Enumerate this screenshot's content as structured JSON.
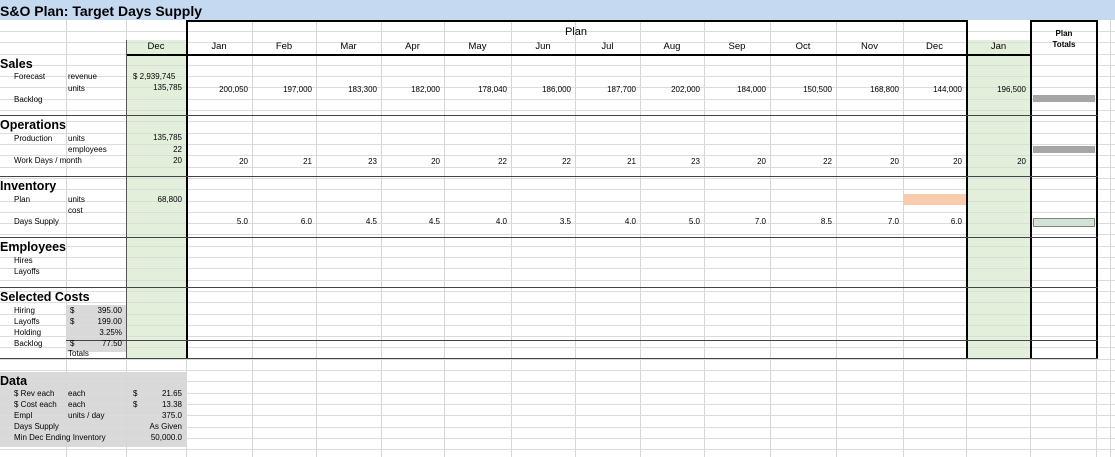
{
  "title": "S&O Plan:  Target Days Supply",
  "colors": {
    "title_band": "#c5d9f1",
    "green_column": "#e2efda",
    "gray_panel": "#d9d9d9",
    "peach_cell": "#f8cbad",
    "gray_bar": "#a6a6a6",
    "light_bar": "#d4e3d6"
  },
  "header": {
    "plan_label": "Plan",
    "plan_totals_line1": "Plan",
    "plan_totals_line2": "Totals",
    "months": [
      "Dec",
      "Jan",
      "Feb",
      "Mar",
      "Apr",
      "May",
      "Jun",
      "Jul",
      "Aug",
      "Sep",
      "Oct",
      "Nov",
      "Dec",
      "Jan"
    ]
  },
  "sections": {
    "sales": {
      "title": "Sales",
      "forecast_label": "Forecast",
      "revenue_label": "revenue",
      "units_label": "units",
      "backlog_label": "Backlog",
      "dec_revenue": "$ 2,939,745",
      "dec_units": "135,785",
      "units": [
        "200,050",
        "197,000",
        "183,300",
        "182,000",
        "178,040",
        "186,000",
        "187,700",
        "202,000",
        "184,000",
        "150,500",
        "168,800",
        "144,000"
      ],
      "jan_units": "196,500"
    },
    "operations": {
      "title": "Operations",
      "production_label": "Production",
      "units_label": "units",
      "employees_label": "employees",
      "workdays_label": "Work Days / month",
      "dec_units": "135,785",
      "dec_employees": "22",
      "dec_workdays": "20",
      "workdays": [
        "20",
        "21",
        "23",
        "20",
        "22",
        "22",
        "21",
        "23",
        "20",
        "22",
        "20",
        "20"
      ],
      "jan_workdays": "20"
    },
    "inventory": {
      "title": "Inventory",
      "plan_label": "Plan",
      "units_label": "units",
      "cost_label": "cost",
      "days_supply_label": "Days Supply",
      "dec_units": "68,800",
      "days_supply": [
        "5.0",
        "6.0",
        "4.5",
        "4.5",
        "4.0",
        "3.5",
        "4.0",
        "5.0",
        "7.0",
        "8.5",
        "7.0",
        "6.0"
      ]
    },
    "employees": {
      "title": "Employees",
      "hires_label": "Hires",
      "layoffs_label": "Layoffs"
    },
    "costs": {
      "title": "Selected Costs",
      "rows": [
        {
          "label": "Hiring",
          "cur": "$",
          "value": "395.00"
        },
        {
          "label": "Layoffs",
          "cur": "$",
          "value": "199.00"
        },
        {
          "label": "Holding",
          "cur": "",
          "value": "3.25%"
        },
        {
          "label": "Backlog",
          "cur": "$",
          "value": "77.50"
        }
      ],
      "totals_label": "Totals"
    },
    "data": {
      "title": "Data",
      "rows": [
        {
          "a": "$ Rev each",
          "b": "each",
          "cur": "$",
          "value": "21.65"
        },
        {
          "a": "$ Cost each",
          "b": "each",
          "cur": "$",
          "value": "13.38"
        },
        {
          "a": "Empl",
          "b": "units / day",
          "cur": "",
          "value": "375.0"
        },
        {
          "a": "Days Supply",
          "b": "",
          "cur": "",
          "value": "As Given"
        },
        {
          "a": "Min Dec Ending Inventory",
          "b": "",
          "cur": "",
          "value": "50,000.0"
        }
      ]
    }
  }
}
